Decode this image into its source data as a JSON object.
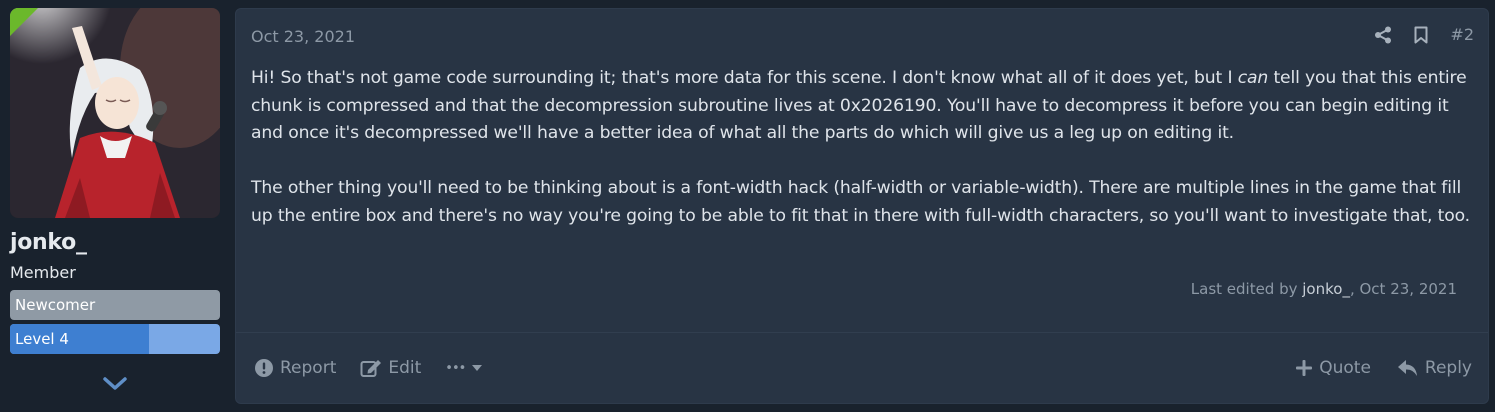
{
  "user": {
    "username": "jonko_",
    "title": "Member",
    "badges": [
      {
        "label": "Newcomer",
        "color": "#8f9aa5"
      },
      {
        "label": "Level 4",
        "color": "#3e7fd1",
        "progress": 0.66
      }
    ],
    "expand_icon": "chevron-down-icon"
  },
  "post": {
    "date": "Oct 23, 2021",
    "number": "#2",
    "tools": [
      "share-icon",
      "bookmark-icon"
    ],
    "body": {
      "p1_before": "Hi! So that's not game code surrounding it; that's more data for this scene. I don't know what all of it does yet, but I ",
      "p1_emphasis": "can",
      "p1_after": " tell you that this entire chunk is compressed and that the decompression subroutine lives at 0x2026190. You'll have to decompress it before you can begin editing it and once it's decompressed we'll have a better idea of what all the parts do which will give us a leg up on editing it.",
      "p2": "The other thing you'll need to be thinking about is a font-width hack (half-width or variable-width). There are multiple lines in the game that fill up the entire box and there's no way you're going to be able to fit that in there with full-width characters, so you'll want to investigate that, too."
    },
    "edited": {
      "prefix": "Last edited by ",
      "user": "jonko_",
      "date": ", Oct 23, 2021"
    }
  },
  "actions": {
    "report": "Report",
    "edit": "Edit",
    "more": "•••",
    "quote": "Quote",
    "reply": "Reply"
  },
  "colors": {
    "page_bg": "#19222d",
    "card_bg": "#283444",
    "muted_text": "#8d99a6",
    "accent_green": "#6bb82b"
  }
}
